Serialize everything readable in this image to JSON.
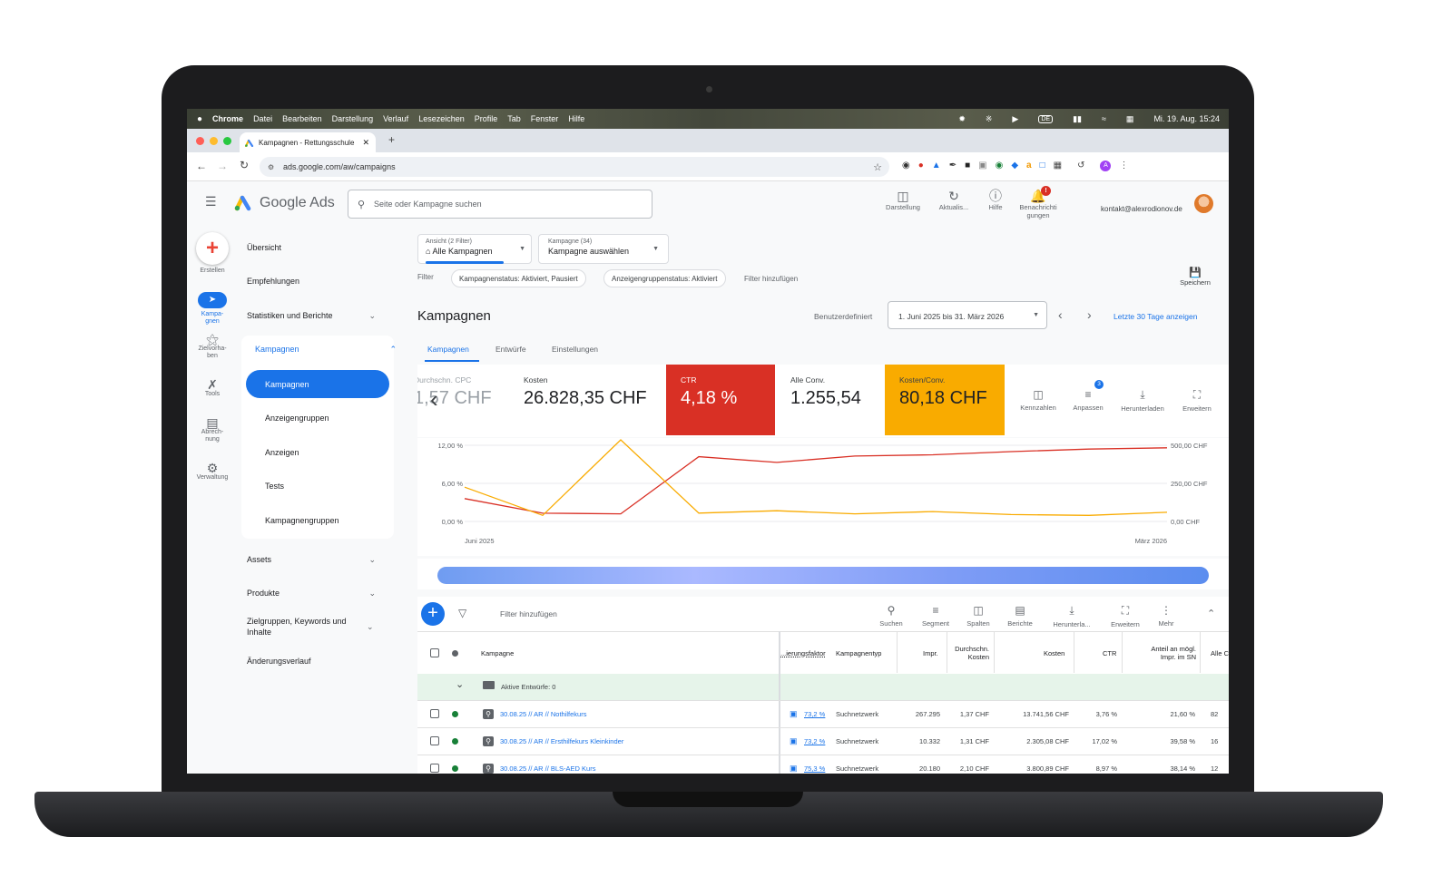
{
  "menubar": {
    "apple": "",
    "items": [
      "Chrome",
      "Datei",
      "Bearbeiten",
      "Darstellung",
      "Verlauf",
      "Lesezeichen",
      "Profile",
      "Tab",
      "Fenster",
      "Hilfe"
    ],
    "input_source": "DE",
    "datetime": "Mi. 19. Aug.  15:24"
  },
  "browser": {
    "tab_title": "Kampagnen - Rettungsschule",
    "url": "ads.google.com/aw/campaigns"
  },
  "ads": {
    "logo_text": "Google Ads",
    "search_placeholder": "Seite oder Kampagne suchen",
    "top_actions": [
      {
        "label": "Darstellung",
        "icon": "bar-chart-icon"
      },
      {
        "label": "Aktualis...",
        "icon": "refresh-icon"
      },
      {
        "label": "Hilfe",
        "icon": "help-icon"
      },
      {
        "label": "Benachrichti gungen",
        "icon": "bell-icon"
      }
    ],
    "notification_badge": "!",
    "account_email": "kontakt@alexrodionov.de",
    "rail": [
      {
        "label": "Erstellen",
        "icon": "plus-icon"
      },
      {
        "label": "Kampa-gnen",
        "icon": "campaign-icon"
      },
      {
        "label": "Zielvorha-ben",
        "icon": "trophy-icon"
      },
      {
        "label": "Tools",
        "icon": "tools-icon"
      },
      {
        "label": "Abrech-nung",
        "icon": "credit-card-icon"
      },
      {
        "label": "Verwaltung",
        "icon": "gear-icon"
      }
    ],
    "nav": {
      "overview": "Übersicht",
      "recommendations": "Empfehlungen",
      "stats": "Statistiken und Berichte",
      "campaigns_group": "Kampagnen",
      "sub": [
        "Kampagnen",
        "Anzeigengruppen",
        "Anzeigen",
        "Tests",
        "Kampagnengruppen"
      ],
      "assets": "Assets",
      "products": "Produkte",
      "audiences": "Zielgruppen, Keywords und Inhalte",
      "history": "Änderungsverlauf"
    },
    "view_select": {
      "label": "Ansicht (2 Filter)",
      "value": "Alle Kampagnen"
    },
    "campaign_select": {
      "label": "Kampagne (34)",
      "value": "Kampagne auswählen"
    },
    "filter_label": "Filter",
    "filters": [
      "Kampagnenstatus: Aktiviert, Pausiert",
      "Anzeigengruppenstatus: Aktiviert"
    ],
    "add_filter": "Filter hinzufügen",
    "save_label": "Speichern",
    "page_title": "Kampagnen",
    "date_mode": "Benutzerdefiniert",
    "date_range": "1. Juni 2025 bis 31. März 2026",
    "last30": "Letzte 30 Tage anzeigen",
    "tabs": [
      "Kampagnen",
      "Entwürfe",
      "Einstellungen"
    ],
    "metrics": [
      {
        "label": "Durchschn. CPC",
        "value": "1,57 CHF",
        "color": "#ffffff"
      },
      {
        "label": "Kosten",
        "value": "26.828,35 CHF",
        "color": "#ffffff"
      },
      {
        "label": "CTR",
        "value": "4,18 %",
        "color": "#d93025"
      },
      {
        "label": "Alle Conv.",
        "value": "1.255,54",
        "color": "#ffffff"
      },
      {
        "label": "Kosten/Conv.",
        "value": "80,18 CHF",
        "color": "#f9ab00"
      }
    ],
    "metric_tools": [
      {
        "label": "Kennzahlen",
        "icon": "chart-add-icon"
      },
      {
        "label": "Anpassen",
        "icon": "tune-icon"
      },
      {
        "label": "Herunterladen",
        "icon": "download-icon"
      },
      {
        "label": "Erweitern",
        "icon": "expand-icon"
      }
    ],
    "adjust_badge": "3",
    "table_tools": [
      {
        "label": "Suchen",
        "icon": "search-icon"
      },
      {
        "label": "Segment",
        "icon": "segment-icon"
      },
      {
        "label": "Spalten",
        "icon": "columns-icon"
      },
      {
        "label": "Berichte",
        "icon": "reports-icon"
      },
      {
        "label": "Herunterla...",
        "icon": "download-icon"
      },
      {
        "label": "Erweitern",
        "icon": "expand-icon"
      },
      {
        "label": "Mehr",
        "icon": "more-vert-icon"
      }
    ],
    "table_filter": "Filter hinzufügen",
    "columns": [
      "Kampagne",
      "...ierungsfaktor",
      "Kampagnentyp",
      "Impr.",
      "Durchschn. Kosten",
      "Kosten",
      "CTR",
      "Anteil an mögl. Impr. im SN",
      "Alle C"
    ],
    "drafts_row": "Aktive Entwürfe: 0",
    "rows": [
      {
        "name": "30.08.25 // AR // Nothilfekurs",
        "factor": "73,2 %",
        "type": "Suchnetzwerk",
        "impr": "267.295",
        "avg_cost": "1,37 CHF",
        "cost": "13.741,56 CHF",
        "ctr": "3,76 %",
        "share": "21,60 %",
        "allc": "82"
      },
      {
        "name": "30.08.25 // AR // Ersthilfekurs Kleinkinder",
        "factor": "73,2 %",
        "type": "Suchnetzwerk",
        "impr": "10.332",
        "avg_cost": "1,31 CHF",
        "cost": "2.305,08 CHF",
        "ctr": "17,02 %",
        "share": "39,58 %",
        "allc": "16"
      },
      {
        "name": "30.08.25 // AR // BLS-AED Kurs",
        "factor": "75,3 %",
        "type": "Suchnetzwerk",
        "impr": "20.180",
        "avg_cost": "2,10 CHF",
        "cost": "3.800,89 CHF",
        "ctr": "8,97 %",
        "share": "38,14 %",
        "allc": "12"
      }
    ]
  },
  "chart_data": {
    "type": "line",
    "x": [
      "Juni 2025",
      "",
      "",
      "",
      "",
      "",
      "",
      "",
      "",
      "März 2026"
    ],
    "x_tick_labels": [
      "Juni 2025",
      "März 2026"
    ],
    "y_left_ticks": [
      "0,00 %",
      "6,00 %",
      "12,00 %"
    ],
    "y_right_ticks": [
      "0,00 CHF",
      "250,00 CHF",
      "500,00 CHF"
    ],
    "ylim_left": [
      0,
      12
    ],
    "ylim_right": [
      0,
      500
    ],
    "series": [
      {
        "color": "#d93025",
        "axis": "left",
        "values": [
          3.6,
          1.3,
          1.2,
          10.2,
          9.3,
          10.3,
          10.5,
          11.0,
          11.4,
          11.6
        ]
      },
      {
        "color": "#f9ab00",
        "axis": "right",
        "values": [
          225,
          40,
          600,
          55,
          70,
          50,
          65,
          45,
          40,
          60
        ]
      }
    ],
    "grid": true
  }
}
